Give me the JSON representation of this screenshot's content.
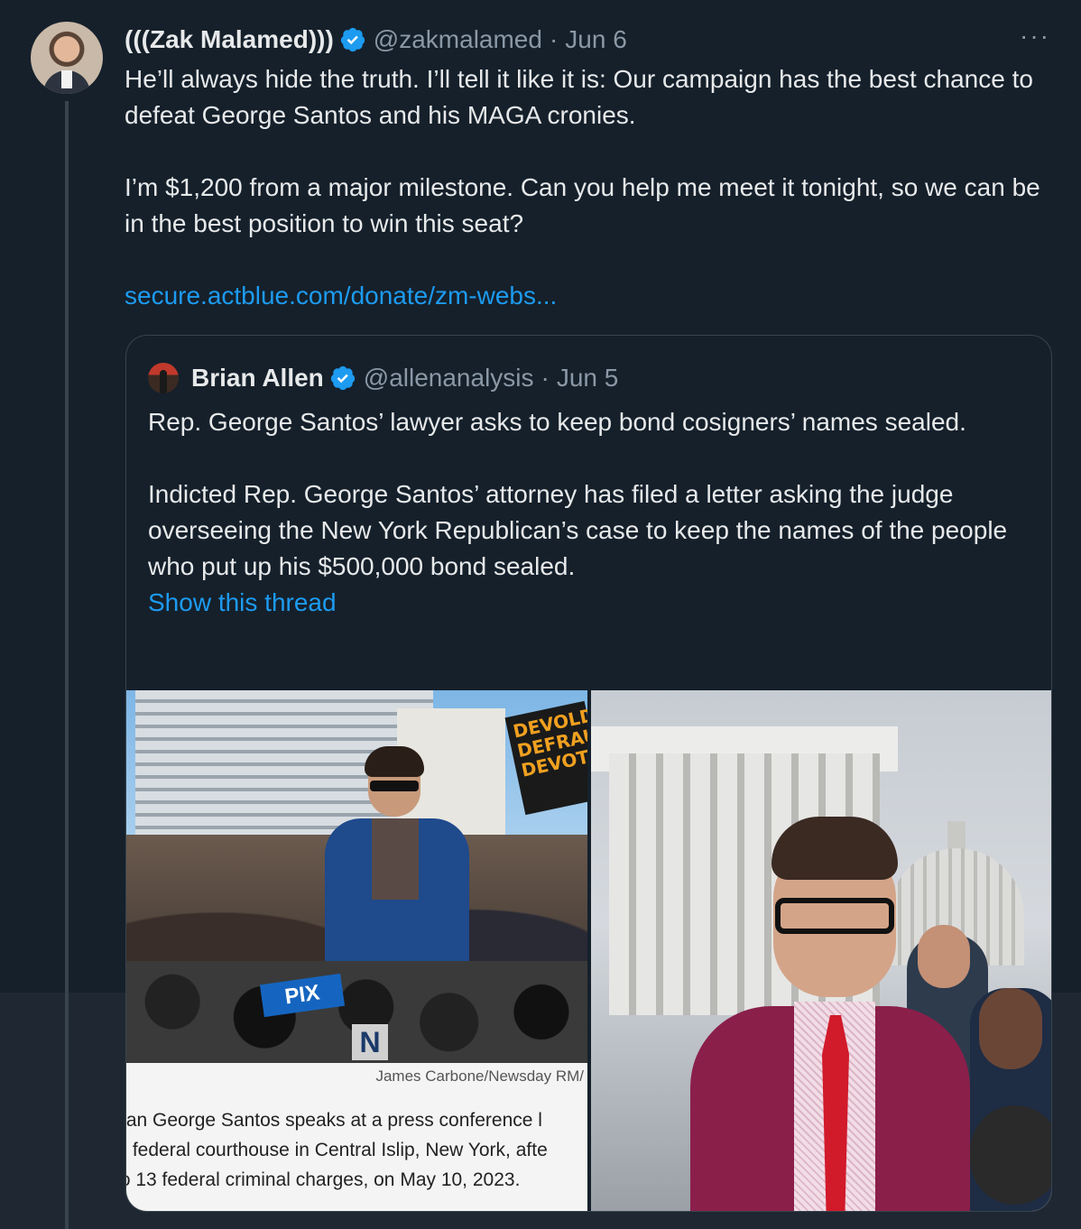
{
  "tweet": {
    "author_name": "(((Zak Malamed)))",
    "handle": "@zakmalamed",
    "separator": "·",
    "date": "Jun 6",
    "more_label": "···",
    "text_p1": "He’ll always hide the truth. I’ll tell it like it is: Our campaign has the best chance to defeat George Santos and his MAGA cronies.",
    "text_p2": "I’m $1,200 from a major milestone. Can you help me meet it tonight, so we can be in the best position to win this seat?",
    "link": "secure.actblue.com/donate/zm-webs..."
  },
  "quote": {
    "author_name": "Brian Allen",
    "handle": "@allenanalysis",
    "separator": "·",
    "date": "Jun 5",
    "text_p1": "Rep. George Santos’ lawyer asks to keep bond cosigners’ names sealed.",
    "text_p2": "Indicted Rep. George Santos’ attorney has filed a letter asking the judge overseeing the New York Republican’s case to keep the names of the people who put up his $500,000 bond sealed.",
    "show_thread": "Show this thread",
    "media_left": {
      "sign_text": "DEVOLD DEFRAU DEVOTE",
      "logo_text": "PIX",
      "mic_flag": "N",
      "credit": "James Carbone/Newsday RM/",
      "caption_lines": [
        "ıan George Santos speaks at a press conference l",
        "· federal courthouse in Central Islip, New York, afte",
        "ɔ 13 federal criminal charges, on May 10, 2023."
      ]
    }
  },
  "colors": {
    "background": "#15202b",
    "link": "#1d9bf0",
    "verified": "#1d9bf0",
    "secondary_text": "#8b98a5",
    "border": "#38444d"
  }
}
